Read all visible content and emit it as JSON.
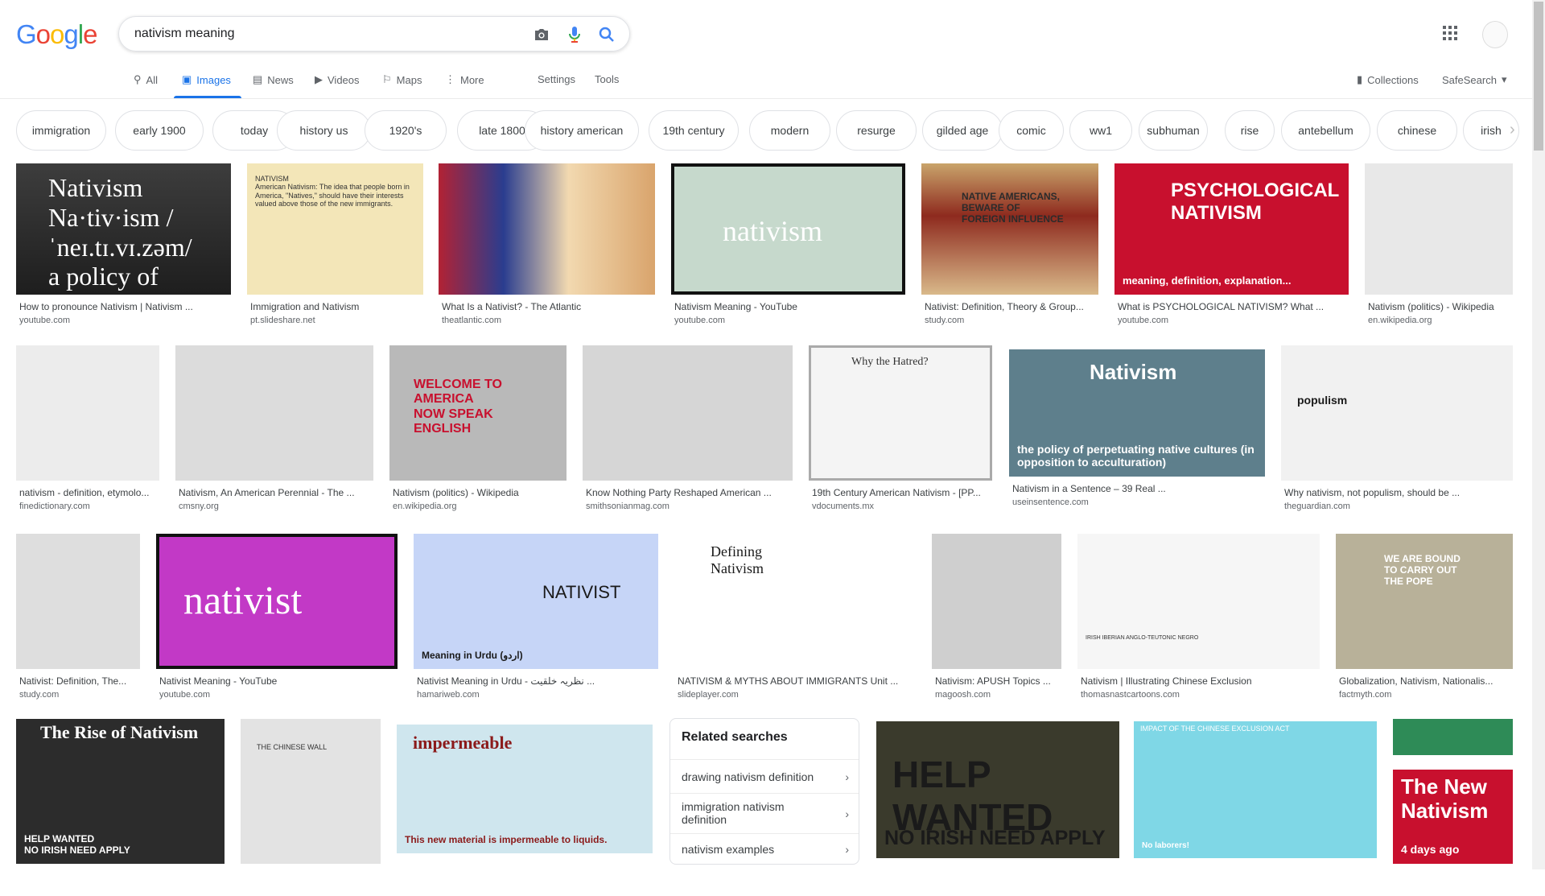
{
  "logo": {
    "letters": [
      "G",
      "o",
      "o",
      "g",
      "l",
      "e"
    ],
    "colors": [
      "#4285F4",
      "#EA4335",
      "#FBBC05",
      "#4285F4",
      "#34A853",
      "#EA4335"
    ]
  },
  "search": {
    "query": "nativism meaning"
  },
  "nav": {
    "all": "All",
    "images": "Images",
    "news": "News",
    "videos": "Videos",
    "maps": "Maps",
    "more": "More",
    "settings": "Settings",
    "tools": "Tools",
    "collections": "Collections",
    "safesearch": "SafeSearch"
  },
  "chips": [
    "immigration",
    "early 1900",
    "today",
    "history us",
    "1920's",
    "late 1800",
    "history american",
    "19th century",
    "modern",
    "resurge",
    "gilded age",
    "comic",
    "ww1",
    "subhuman",
    "rise",
    "antebellum",
    "chinese",
    "irish"
  ],
  "results": [
    {
      "title": "How to pronounce Nativism | Nativism ...",
      "source": "youtube.com",
      "thumb_text": "Nativism\nNa·tiv·ism  /ˈneɪ.tɪ.vɪ.zəm/\na policy of favoring native inhabitants as opposed to immigrants"
    },
    {
      "title": "Immigration and Nativism",
      "source": "pt.slideshare.net",
      "thumb_text": "NATIVISM\nAmerican Nativism: The idea that people born in America, \"Natives,\" should have their interests valued above those of the new immigrants."
    },
    {
      "title": "What Is a Nativist? - The Atlantic",
      "source": "theatlantic.com",
      "thumb_text": ""
    },
    {
      "title": "Nativism Meaning - YouTube",
      "source": "youtube.com",
      "thumb_text": "nativism"
    },
    {
      "title": "Nativist: Definition, Theory & Group...",
      "source": "study.com",
      "thumb_text": "NATIVE AMERICANS,\nBEWARE OF\nFOREIGN INFLUENCE"
    },
    {
      "title": "What is PSYCHOLOGICAL NATIVISM? What ...",
      "source": "youtube.com",
      "thumb_text": "PSYCHOLOGICAL\nNATIVISM",
      "thumb_sub": "meaning, definition, explanation..."
    },
    {
      "title": "Nativism (politics) - Wikipedia",
      "source": "en.wikipedia.org",
      "thumb_text": ""
    },
    {
      "title": "nativism - definition, etymolo...",
      "source": "finedictionary.com",
      "thumb_text": ""
    },
    {
      "title": "Nativism, An American Perennial - The ...",
      "source": "cmsny.org",
      "thumb_text": ""
    },
    {
      "title": "Nativism (politics) - Wikipedia",
      "source": "en.wikipedia.org",
      "thumb_text": "WELCOME TO AMERICA\nNOW SPEAK\nENGLISH"
    },
    {
      "title": "Know Nothing Party Reshaped American ...",
      "source": "smithsonianmag.com",
      "thumb_text": ""
    },
    {
      "title": "19th Century American Nativism - [PP...",
      "source": "vdocuments.mx",
      "thumb_text": "Why the Hatred?"
    },
    {
      "title": "Nativism in a Sentence – 39 Real ...",
      "source": "useinsentence.com",
      "thumb_text": "Nativism",
      "thumb_sub": "the policy of perpetuating native cultures (in opposition to acculturation)"
    },
    {
      "title": "Why nativism, not populism, should be ...",
      "source": "theguardian.com",
      "thumb_text": "populism"
    },
    {
      "title": "Nativist: Definition, The...",
      "source": "study.com",
      "thumb_text": ""
    },
    {
      "title": "Nativist Meaning - YouTube",
      "source": "youtube.com",
      "thumb_text": "nativist"
    },
    {
      "title": "Nativist Meaning in Urdu - نظریہ خلقیت ...",
      "source": "hamariweb.com",
      "thumb_text": "NATIVIST",
      "thumb_sub": "Meaning in Urdu (اردو)"
    },
    {
      "title": "NATIVISM & MYTHS ABOUT IMMIGRANTS Unit ...",
      "source": "slideplayer.com",
      "thumb_text": "Defining\nNativism"
    },
    {
      "title": "Nativism: APUSH Topics ...",
      "source": "magoosh.com",
      "thumb_text": ""
    },
    {
      "title": "Nativism | Illustrating Chinese Exclusion",
      "source": "thomasnastcartoons.com",
      "thumb_text": "IRISH IBERIAN     ANGLO-TEUTONIC     NEGRO"
    },
    {
      "title": "Globalization, Nativism, Nationalis...",
      "source": "factmyth.com",
      "thumb_text": "WE ARE BOUND\nTO CARRY OUT\nTHE POPE"
    },
    {
      "title": "",
      "source": "",
      "thumb_text": "The Rise of Nativism",
      "thumb_sub": "HELP WANTED\nNO IRISH NEED APPLY"
    },
    {
      "title": "",
      "source": "",
      "thumb_text": "THE CHINESE WALL"
    },
    {
      "title": "",
      "source": "",
      "thumb_text": "impermeable",
      "thumb_sub": "This new material is impermeable to liquids."
    },
    {
      "title": "",
      "source": "",
      "thumb_text": "HELP WANTED",
      "thumb_sub": "NO IRISH NEED APPLY"
    },
    {
      "title": "",
      "source": "",
      "thumb_text": "IMPACT OF THE CHINESE EXCLUSION ACT",
      "thumb_sub": "No laborers!"
    },
    {
      "title": "",
      "source": "",
      "thumb_text": "The New\nNativism",
      "thumb_sub": "4 days ago"
    }
  ],
  "related": {
    "header": "Related searches",
    "items": [
      "drawing nativism definition",
      "immigration nativism definition",
      "nativism examples"
    ]
  }
}
